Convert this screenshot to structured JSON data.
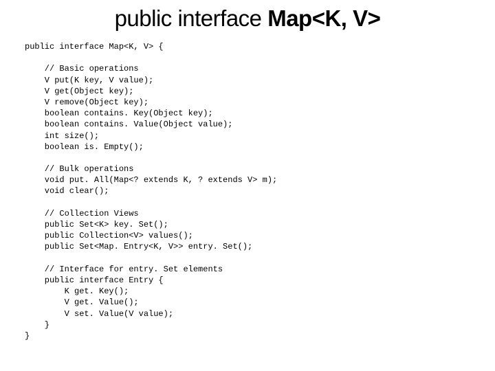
{
  "title_plain": "public interface ",
  "title_bold": "Map<K, V>",
  "code": "public interface Map<K, V> {\n\n    // Basic operations\n    V put(K key, V value);\n    V get(Object key);\n    V remove(Object key);\n    boolean contains. Key(Object key);\n    boolean contains. Value(Object value);\n    int size();\n    boolean is. Empty();\n\n    // Bulk operations\n    void put. All(Map<? extends K, ? extends V> m);\n    void clear();\n\n    // Collection Views\n    public Set<K> key. Set();\n    public Collection<V> values();\n    public Set<Map. Entry<K, V>> entry. Set();\n\n    // Interface for entry. Set elements\n    public interface Entry {\n        K get. Key();\n        V get. Value();\n        V set. Value(V value);\n    }\n}"
}
